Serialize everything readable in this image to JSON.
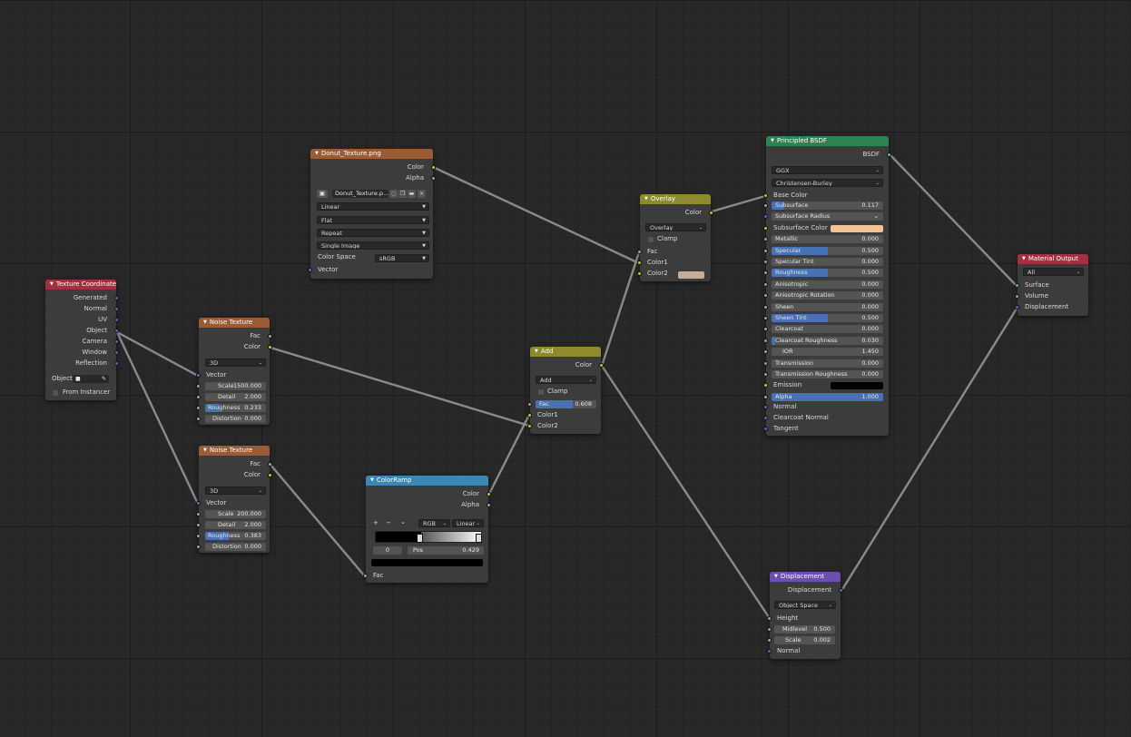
{
  "colors": {
    "header_texture": "#9b5b35",
    "header_input": "#a3303f",
    "header_color": "#8e8a2e",
    "header_converter": "#3d87b3",
    "header_shader": "#2d8450",
    "header_output": "#a3303f",
    "header_vector": "#6c4fb0",
    "accent_fill": "#4772b3",
    "subsurface_color": "#f2c396",
    "overlay_color2": "#c2ae9a",
    "emission": "#000000",
    "link": "#8a8a8a"
  },
  "texcoord": {
    "title": "Texture Coordinate",
    "outputs": [
      "Generated",
      "Normal",
      "UV",
      "Object",
      "Camera",
      "Window",
      "Reflection"
    ],
    "object_label": "Object:",
    "from_instancer": "From Instancer"
  },
  "image": {
    "title": "Donut_Texture.png",
    "out_color": "Color",
    "out_alpha": "Alpha",
    "file": "Donut_Texture.p...",
    "interp": "Linear",
    "projection": "Flat",
    "extension": "Repeat",
    "source": "Single Image",
    "colorspace_label": "Color Space",
    "colorspace": "sRGB",
    "in_vector": "Vector"
  },
  "noise1": {
    "title": "Noise Texture",
    "out_fac": "Fac",
    "out_color": "Color",
    "dims": "3D",
    "in_vector": "Vector",
    "scale_label": "Scale",
    "scale": "1500.000",
    "detail_label": "Detail",
    "detail": "2.000",
    "rough_label": "Roughness",
    "rough": "0.233",
    "dist_label": "Distortion",
    "dist": "0.000"
  },
  "noise2": {
    "title": "Noise Texture",
    "out_fac": "Fac",
    "out_color": "Color",
    "dims": "3D",
    "in_vector": "Vector",
    "scale_label": "Scale",
    "scale": "200.000",
    "detail_label": "Detail",
    "detail": "2.000",
    "rough_label": "Roughness",
    "rough": "0.383",
    "dist_label": "Distortion",
    "dist": "0.000"
  },
  "colorramp": {
    "title": "ColorRamp",
    "out_color": "Color",
    "out_alpha": "Alpha",
    "plus": "+",
    "minus": "−",
    "chev": "⌄",
    "mode": "RGB",
    "interp": "Linear",
    "index": "0",
    "pos_label": "Pos",
    "pos": "0.429",
    "in_fac": "Fac"
  },
  "add": {
    "title": "Add",
    "out_color": "Color",
    "mode": "Add",
    "clamp": "Clamp",
    "fac_label": "Fac",
    "fac": "0.608",
    "fac_value": 0.608,
    "in_color1": "Color1",
    "in_color2": "Color2"
  },
  "overlay": {
    "title": "Overlay",
    "out_color": "Color",
    "mode": "Overlay",
    "clamp": "Clamp",
    "in_fac": "Fac",
    "in_color1": "Color1",
    "in_color2": "Color2"
  },
  "bsdf": {
    "title": "Principled BSDF",
    "out": "BSDF",
    "dist": "GGX",
    "sss": "Christensen-Burley",
    "base_color": "Base Color",
    "params": [
      {
        "label": "Subsurface",
        "value": "0.117",
        "fill": 0.117
      },
      {
        "label": "Subsurface Radius",
        "value": "",
        "fill": 0
      },
      {
        "label": "Subsurface Color",
        "value": "",
        "fill": 0
      },
      {
        "label": "Metallic",
        "value": "0.000",
        "fill": 0
      },
      {
        "label": "Specular",
        "value": "0.500",
        "fill": 0.5
      },
      {
        "label": "Specular Tint",
        "value": "0.000",
        "fill": 0
      },
      {
        "label": "Roughness",
        "value": "0.500",
        "fill": 0.5
      },
      {
        "label": "Anisotropic",
        "value": "0.000",
        "fill": 0
      },
      {
        "label": "Anisotropic Rotation",
        "value": "0.000",
        "fill": 0
      },
      {
        "label": "Sheen",
        "value": "0.000",
        "fill": 0
      },
      {
        "label": "Sheen Tint",
        "value": "0.500",
        "fill": 0.5
      },
      {
        "label": "Clearcoat",
        "value": "0.000",
        "fill": 0
      },
      {
        "label": "Clearcoat Roughness",
        "value": "0.030",
        "fill": 0.03
      },
      {
        "label": "IOR",
        "value": "1.450",
        "fill": 0
      },
      {
        "label": "Transmission",
        "value": "0.000",
        "fill": 0
      },
      {
        "label": "Transmission Roughness",
        "value": "0.000",
        "fill": 0
      },
      {
        "label": "Emission",
        "value": "",
        "fill": 0
      },
      {
        "label": "Alpha",
        "value": "1.000",
        "fill": 1
      }
    ],
    "normal": "Normal",
    "clearcoat_normal": "Clearcoat Normal",
    "tangent": "Tangent"
  },
  "output": {
    "title": "Material Output",
    "target": "All",
    "surface": "Surface",
    "volume": "Volume",
    "displacement": "Displacement"
  },
  "displacement": {
    "title": "Displacement",
    "out": "Displacement",
    "space": "Object Space",
    "height": "Height",
    "midlevel_label": "Midlevel",
    "midlevel": "0.500",
    "scale_label": "Scale",
    "scale": "0.002",
    "normal": "Normal"
  }
}
